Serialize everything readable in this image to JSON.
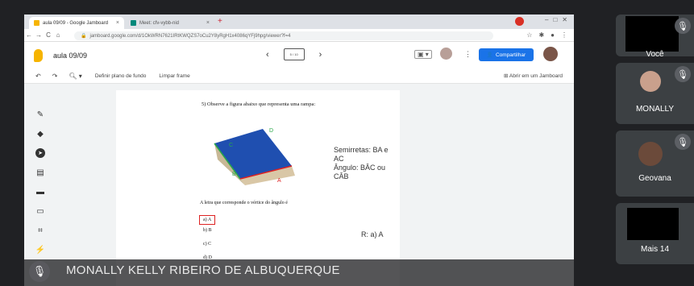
{
  "browser": {
    "tabs": [
      {
        "label": "aula 09/09 - Google Jamboard"
      },
      {
        "label": "Meet: cfv-vybb-nid"
      }
    ],
    "url": "jamboard.google.com/d/1OkWRN7621IRtKWQZS7oCu2Y8yRgH1x4086qYFj9hpg/viewer?f=4"
  },
  "jamboard": {
    "title": "aula 09/09",
    "frame_indicator": "5 / 10",
    "share_label": "Compartilhar",
    "toolbar": {
      "background_label": "Definir plano de fundo",
      "clear_label": "Limpar frame",
      "open_label": "Abrir em um Jamboard"
    }
  },
  "content": {
    "question": "5) Observe a figura abaixo que representa uma rampa:",
    "vertex_labels": {
      "c": "C",
      "d": "D",
      "b": "B",
      "a": "A"
    },
    "semirretas": "Semirretas: BA e AC",
    "angulo": "Ângulo: BÂC ou CÂB",
    "prompt": "A letra que corresponde o vértice do ângulo é",
    "options": [
      "a) A",
      "b) B",
      "c) C",
      "d) D"
    ],
    "answer": "R: a) A"
  },
  "presenter": {
    "name": "MONALLY KELLY RIBEIRO DE ALBUQUERQUE"
  },
  "participants": [
    {
      "name": "Você"
    },
    {
      "name": "MONALLY"
    },
    {
      "name": "Geovana"
    },
    {
      "name": "Mais 14"
    }
  ]
}
